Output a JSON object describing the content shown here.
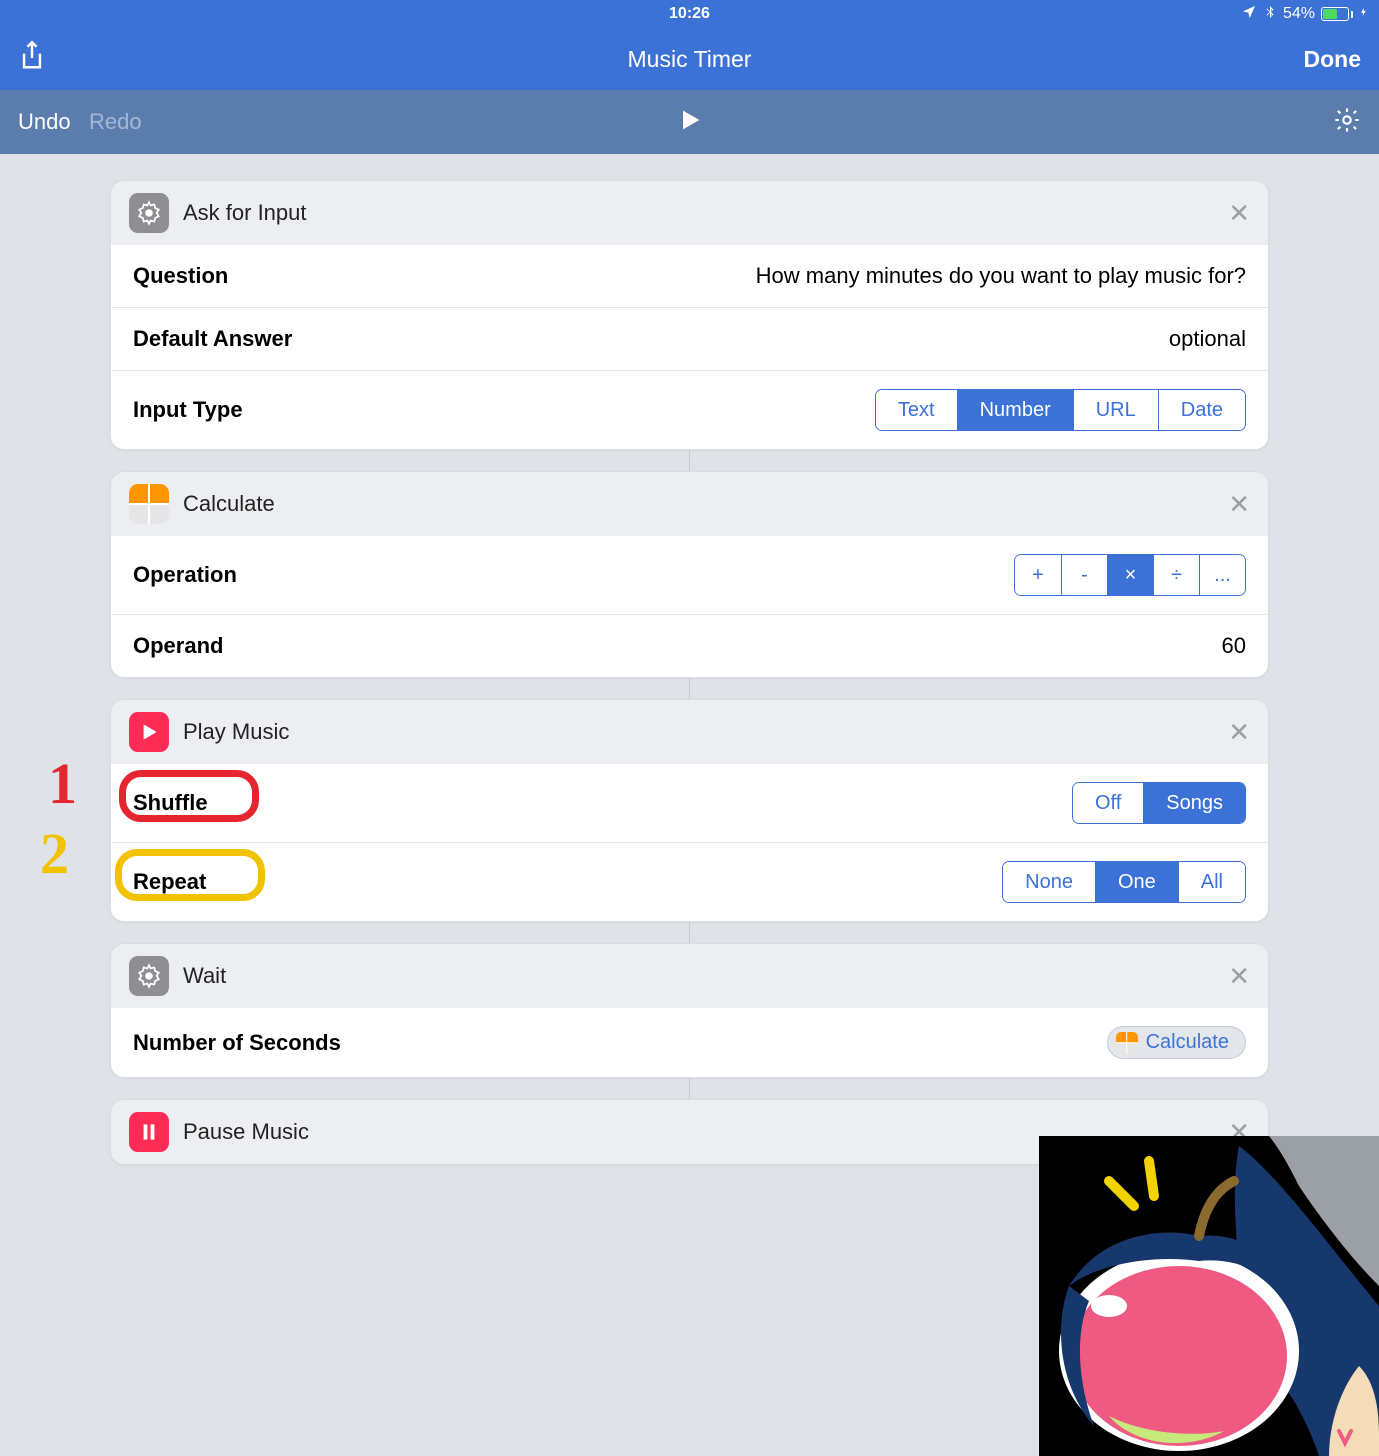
{
  "status": {
    "time": "10:26",
    "battery_pct": "54%"
  },
  "nav": {
    "title": "Music Timer",
    "done": "Done"
  },
  "toolbar": {
    "undo": "Undo",
    "redo": "Redo"
  },
  "annotations": {
    "n1": "1",
    "n2": "2"
  },
  "actions": [
    {
      "title": "Ask for Input",
      "rows": {
        "question_label": "Question",
        "question_value": "How many minutes do you want to play music for?",
        "default_label": "Default Answer",
        "default_placeholder": "optional",
        "type_label": "Input Type",
        "type_options": [
          "Text",
          "Number",
          "URL",
          "Date"
        ],
        "type_selected": "Number"
      }
    },
    {
      "title": "Calculate",
      "rows": {
        "operation_label": "Operation",
        "operation_options": [
          "+",
          "-",
          "×",
          "÷",
          "..."
        ],
        "operation_selected": "×",
        "operand_label": "Operand",
        "operand_value": "60"
      }
    },
    {
      "title": "Play Music",
      "rows": {
        "shuffle_label": "Shuffle",
        "shuffle_options": [
          "Off",
          "Songs"
        ],
        "shuffle_selected": "Songs",
        "repeat_label": "Repeat",
        "repeat_options": [
          "None",
          "One",
          "All"
        ],
        "repeat_selected": "One"
      }
    },
    {
      "title": "Wait",
      "rows": {
        "seconds_label": "Number of Seconds",
        "seconds_token": "Calculate"
      }
    },
    {
      "title": "Pause Music"
    }
  ]
}
